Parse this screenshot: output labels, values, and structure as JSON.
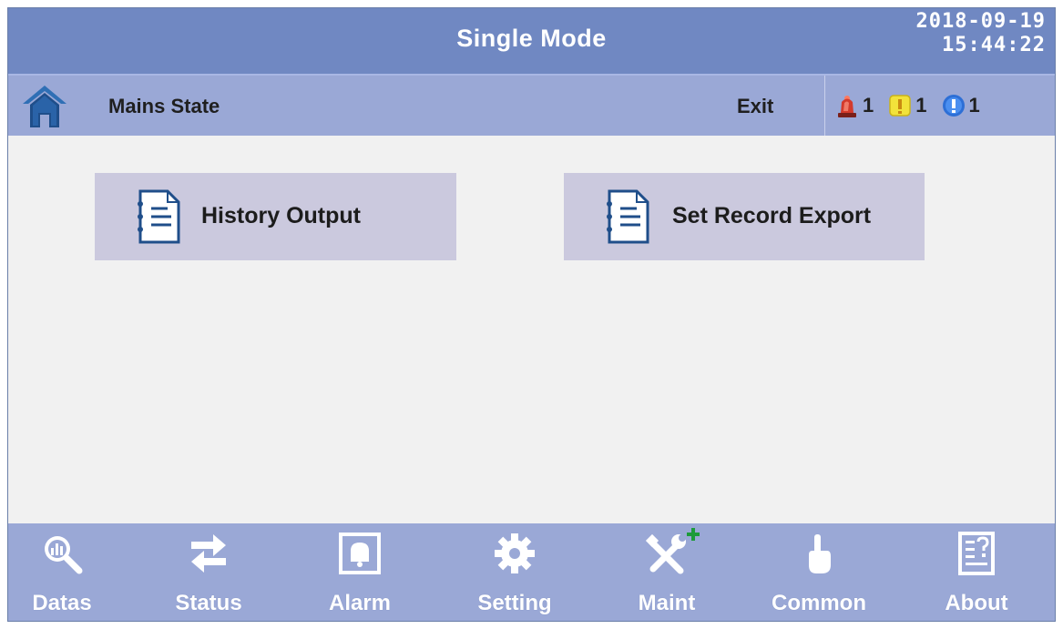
{
  "header": {
    "title": "Single Mode",
    "date": "2018-09-19",
    "time": "15:44:22"
  },
  "subheader": {
    "breadcrumb": "Mains State",
    "exit_label": "Exit",
    "alarm_counts": {
      "critical": "1",
      "warning": "1",
      "info": "1"
    }
  },
  "main": {
    "buttons": [
      {
        "label": "History  Output",
        "icon": "document-list-icon"
      },
      {
        "label": "Set Record Export",
        "icon": "document-list-icon"
      }
    ]
  },
  "nav": {
    "items": [
      {
        "label": "Datas",
        "icon": "data-magnifier-icon"
      },
      {
        "label": "Status",
        "icon": "swap-arrows-icon"
      },
      {
        "label": "Alarm",
        "icon": "bell-icon"
      },
      {
        "label": "Setting",
        "icon": "gear-icon"
      },
      {
        "label": "Maint",
        "icon": "tools-icon"
      },
      {
        "label": "Common",
        "icon": "pointer-hand-icon"
      },
      {
        "label": "About",
        "icon": "about-document-icon"
      }
    ]
  },
  "colors": {
    "title_bar": "#7088c2",
    "sub_bar": "#9aa8d6",
    "nav_bar": "#9aa8d6",
    "button_bg": "#cbc9de",
    "content_bg": "#f1f1f1",
    "critical": "#d33a2c",
    "warning": "#f2e23a",
    "info": "#2d6fd6",
    "maint_plus": "#1d9b3a"
  }
}
